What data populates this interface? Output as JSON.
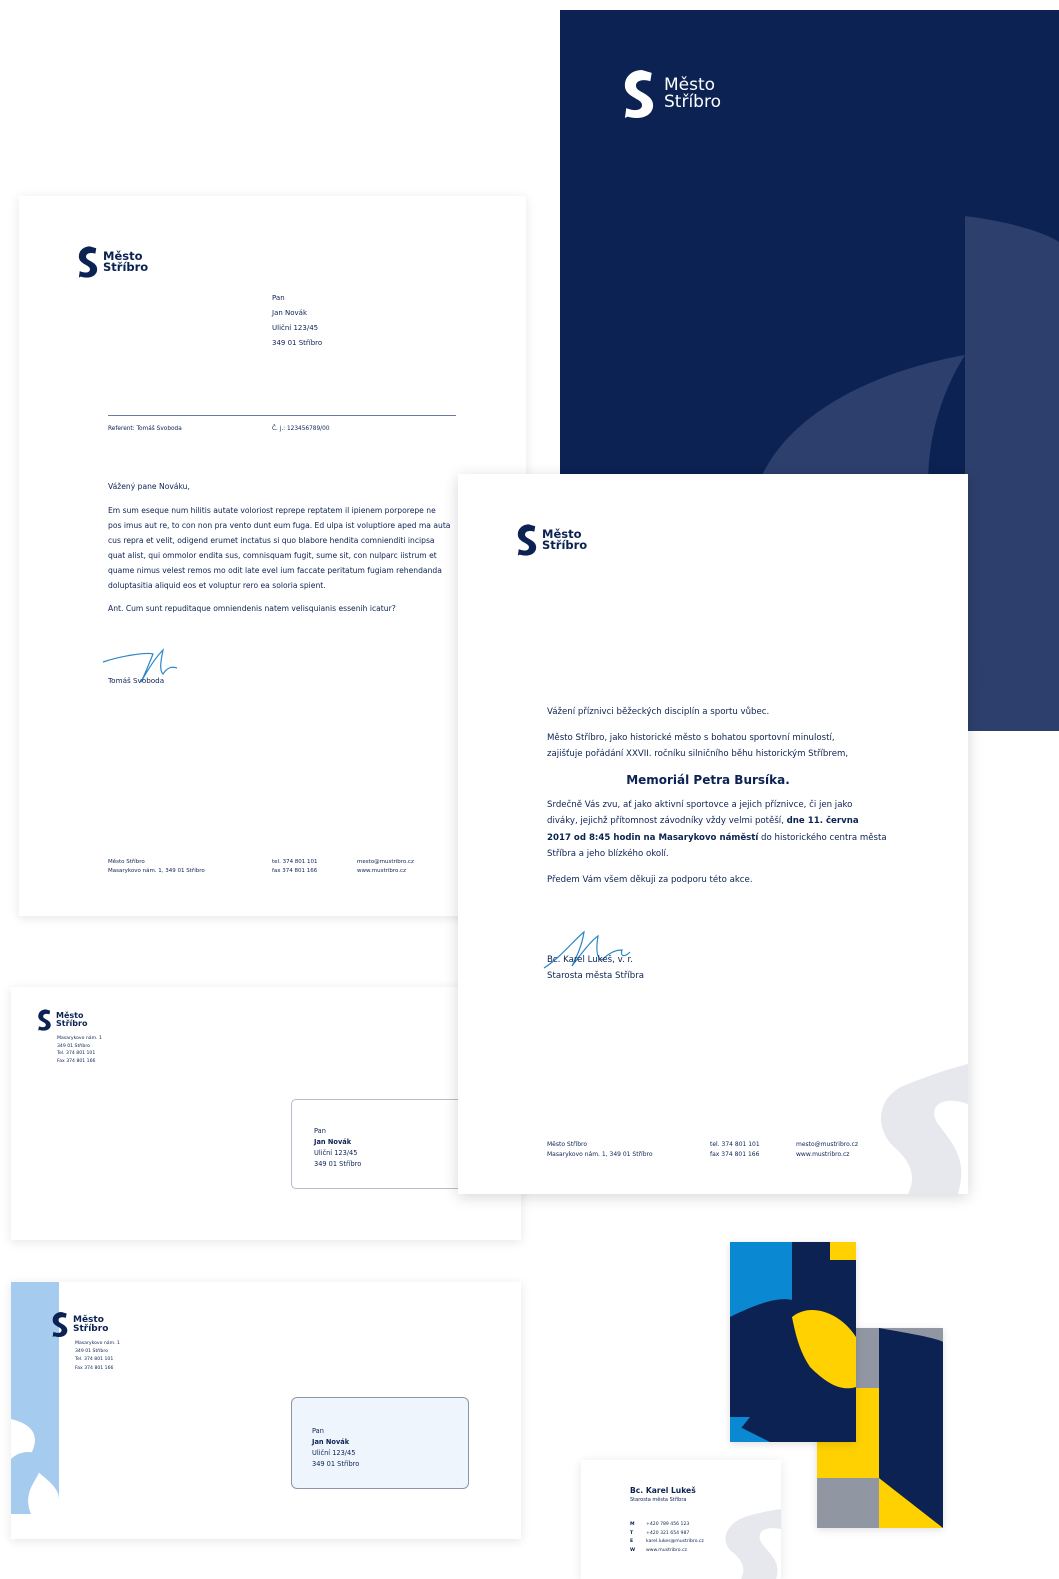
{
  "brand": {
    "logo_line1": "Město",
    "logo_line2": "Stříbro",
    "colors": {
      "navy": "#0b2252",
      "navy_light": "#2d3f6c",
      "blue": "#0a88d2",
      "yellow": "#ffd100",
      "gray": "#9197a2",
      "light_blue": "#a5cbee"
    }
  },
  "letter": {
    "recipient": [
      "Pan",
      "Jan Novák",
      "Uliční 123/45",
      "349 01  Stříbro"
    ],
    "referent": "Referent: Tomáš Svoboda",
    "cj": "Č. j.: 123456789/00",
    "salutation": "Vážený pane Nováku,",
    "body": [
      "Em sum eseque num hilitis autate voloriost reprepe reptatem il ipienem porporepe ne",
      "pos imus aut re, to con non pra vento dunt eum fuga. Ed ulpa ist voluptiore aped ma auta",
      "cus repra et velit, odigend erumet inctatus si quo blabore hendita comnienditi incipsa",
      "quat alist, qui ommolor endita sus, comnisquam fugit, sume sit, con nulparc iistrum et",
      "quame nimus velest remos mo odit late evel ium faccate peritatum fugiam rehendanda",
      "doluptasitia aliquid eos et voluptur rero ea soloria spient."
    ],
    "closing": "Ant. Cum sunt repuditaque omniendenis natem velisquianis essenih icatur?",
    "signature_name": "Tomáš Svoboda",
    "footer": {
      "col1": [
        "Město Stříbro",
        "Masarykovo nám. 1, 349 01 Stříbro"
      ],
      "col2": [
        "tel. 374 801 101",
        "fax 374 801 166"
      ],
      "col3": [
        "mesto@mustribro.cz",
        "www.mustribro.cz"
      ]
    }
  },
  "invitation": {
    "greeting": "Vážení příznivci běžeckých disciplín a sportu vůbec.",
    "para1": [
      "Město Stříbro, jako historické město s bohatou sportovní minulostí,",
      "zajišťuje pořádání XXVII. ročníku silničního běhu historickým Stříbrem,"
    ],
    "event_title": "Memoriál Petra Bursíka.",
    "para2_a": "Srdečně Vás zvu, ať jako aktivní sportovce a jejich příznivce, či jen jako",
    "para2_b_pre": "diváky, jejichž přítomnost závodníky vždy velmi potěší, ",
    "para2_b_bold": "dne 11. června",
    "para2_c_bold": "2017 od 8:45 hodin na Masarykovo náměstí",
    "para2_c_post": " do historického centra města",
    "para2_d": "Stříbra a jeho blízkého okolí.",
    "para3": "Předem Vám všem děkuji za podporu této akce.",
    "signature_name": "Bc. Karel Lukeš, v. r.",
    "signature_title": "Starosta města Stříbra",
    "footer": {
      "col1": [
        "Město Stříbro",
        "Masarykovo nám. 1, 349 01 Stříbro"
      ],
      "col2": [
        "tel. 374 801 101",
        "fax 374 801 166"
      ],
      "col3": [
        "mesto@mustribro.cz",
        "www.mustribro.cz"
      ]
    }
  },
  "envelope1": {
    "sender": [
      "Masarykovo nám. 1",
      "349 01 Stříbro",
      "Tel. 374 801 101",
      "Fax 374 801 166"
    ],
    "recipient": {
      "title": "Pan",
      "name": "Jan Novák",
      "street": "Uliční 123/45",
      "city": "349 01  Stříbro"
    }
  },
  "envelope2": {
    "sender": [
      "Masarykovo nám. 1",
      "349 01 Stříbro",
      "Tel. 374 801 101",
      "Fax 374 801 166"
    ],
    "recipient": {
      "title": "Pan",
      "name": "Jan Novák",
      "street": "Uliční 123/45",
      "city": "349 01  Stříbro"
    }
  },
  "business_card": {
    "name": "Bc. Karel Lukeš",
    "title": "Starosta města Stříbra",
    "rows": [
      {
        "key": "M",
        "value": "+420 789 456 123"
      },
      {
        "key": "T",
        "value": "+420 321 654 987"
      },
      {
        "key": "E",
        "value": "karel.lukes@mustribro.cz"
      },
      {
        "key": "W",
        "value": "www.mustribro.cz"
      }
    ]
  }
}
